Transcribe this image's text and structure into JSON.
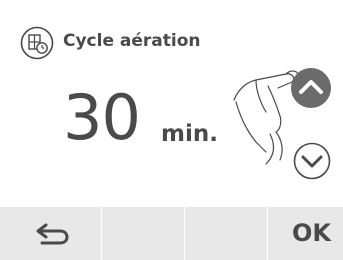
{
  "header": {
    "icon": "window-timer-icon",
    "title": "Cycle aération"
  },
  "setting": {
    "value": "30",
    "unit": "min."
  },
  "controls": {
    "up_icon": "chevron-up-icon",
    "down_icon": "chevron-down-icon",
    "hint_icon": "hand-press-icon"
  },
  "bottom_bar": {
    "back_icon": "return-arrow-icon",
    "ok_label": "OK"
  },
  "colors": {
    "text": "#4a4a4a",
    "up_button": "#6b6b6b",
    "bar": "#e8e8e8"
  }
}
